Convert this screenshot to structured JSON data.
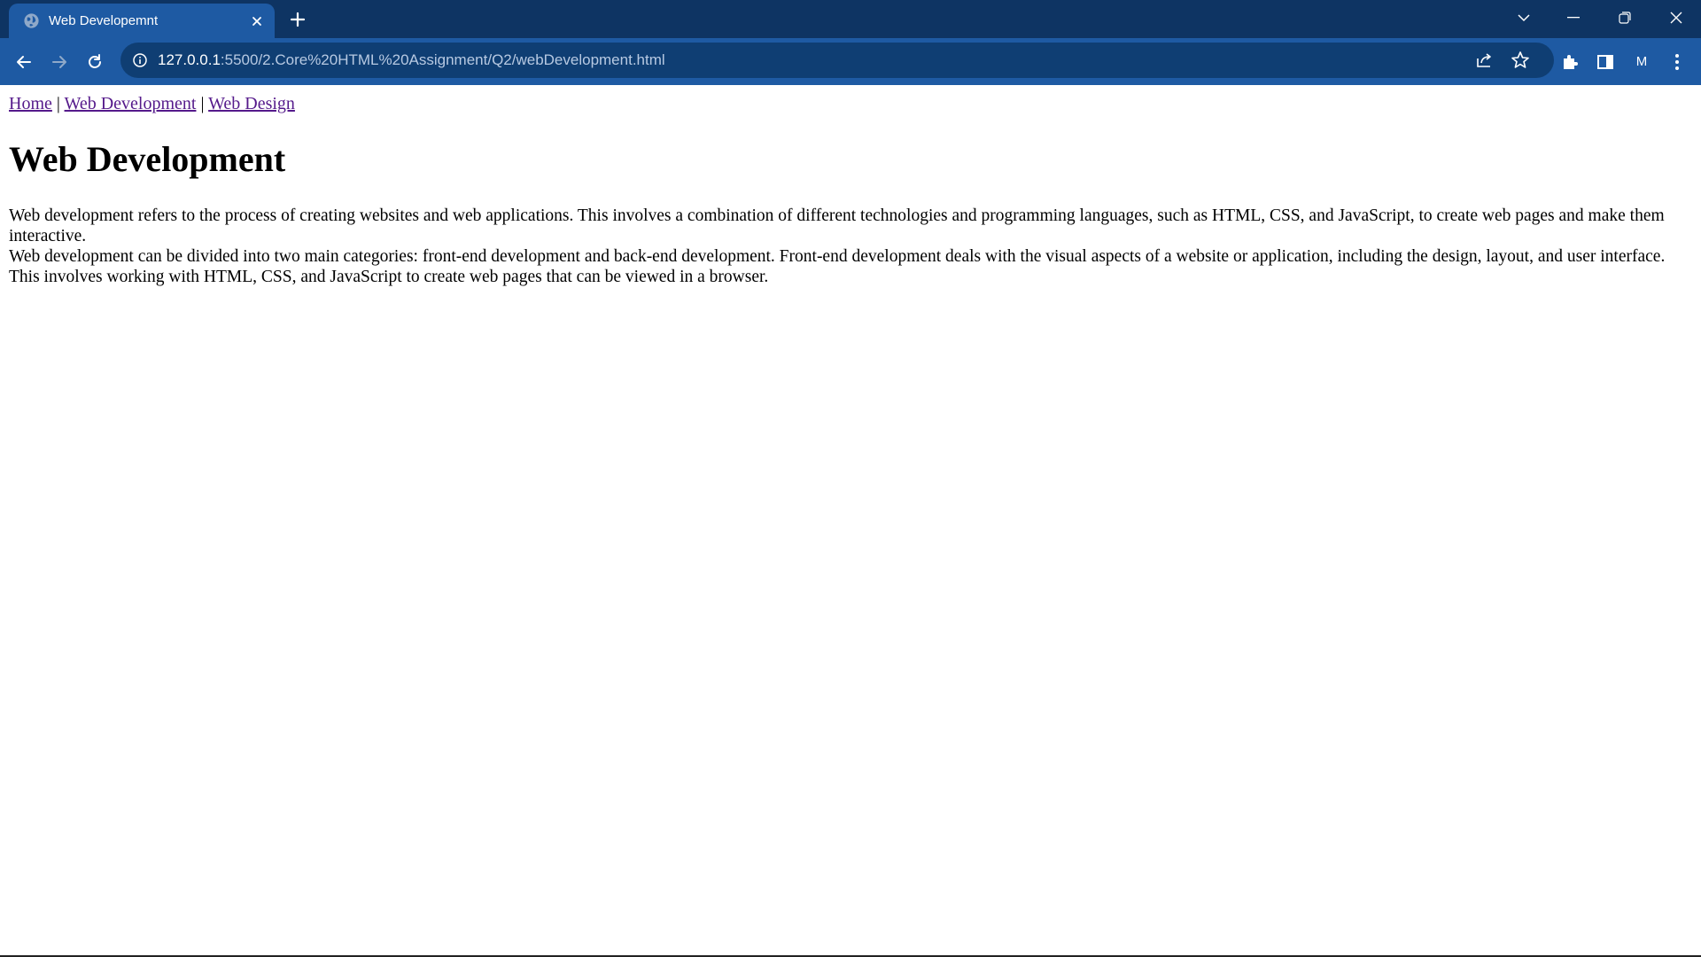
{
  "browser": {
    "tab": {
      "title": "Web Developemnt",
      "favicon": "globe-icon",
      "close_icon": "close-icon"
    },
    "new_tab_icon": "plus-icon",
    "window_controls": [
      "chevron-down-icon",
      "minimize-icon",
      "restore-icon",
      "close-icon"
    ],
    "toolbar": {
      "back_icon": "back-arrow-icon",
      "forward_icon": "forward-arrow-icon",
      "reload_icon": "reload-icon",
      "site_info_icon": "info-icon",
      "url_host": "127.0.0.1",
      "url_rest": ":5500/2.Core%20HTML%20Assignment/Q2/webDevelopment.html",
      "share_icon": "share-icon",
      "bookmark_icon": "star-icon",
      "extensions_icon": "puzzle-icon",
      "side_panel_icon": "side-panel-icon",
      "profile_initial": "M",
      "menu_icon": "kebab-menu-icon"
    },
    "colors": {
      "tabstrip": "#0e3463",
      "toolbar": "#1e5aa3",
      "omnibox": "#0f3e73",
      "visited_link": "#551a8b"
    }
  },
  "page": {
    "nav": {
      "home": "Home",
      "sep1": " | ",
      "web_development": "Web Development",
      "sep2": " | ",
      "web_design": "Web Design"
    },
    "heading": "Web Development",
    "paragraph1": "Web development refers to the process of creating websites and web applications. This involves a combination of different technologies and programming languages, such as HTML, CSS, and JavaScript, to create web pages and make them interactive.",
    "paragraph2": "Web development can be divided into two main categories: front-end development and back-end development. Front-end development deals with the visual aspects of a website or application, including the design, layout, and user interface. This involves working with HTML, CSS, and JavaScript to create web pages that can be viewed in a browser."
  }
}
